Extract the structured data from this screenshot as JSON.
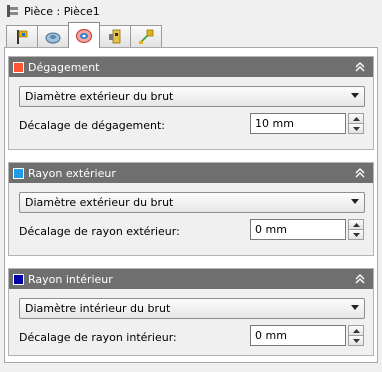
{
  "window": {
    "title": "Pièce : Pièce1"
  },
  "tabs": [
    {
      "icon": "part-flag-icon",
      "active": false
    },
    {
      "icon": "lathe-stock-icon",
      "active": false
    },
    {
      "icon": "clearance-icon",
      "active": true
    },
    {
      "icon": "face-stock-icon",
      "active": false
    },
    {
      "icon": "axis-origin-icon",
      "active": false
    }
  ],
  "sections": [
    {
      "title": "Dégagement",
      "color": "#ff5533",
      "dropdown_value": "Diamètre extérieur du brut",
      "field_label": "Décalage de dégagement:",
      "field_value": "10 mm"
    },
    {
      "title": "Rayon extérieur",
      "color": "#1f9be8",
      "dropdown_value": "Diamètre extérieur du brut",
      "field_label": "Décalage de rayon extérieur:",
      "field_value": "0 mm"
    },
    {
      "title": "Rayon intérieur",
      "color": "#0000aa",
      "dropdown_value": "Diamètre intérieur du brut",
      "field_label": "Décalage de rayon intérieur:",
      "field_value": "0 mm"
    }
  ]
}
